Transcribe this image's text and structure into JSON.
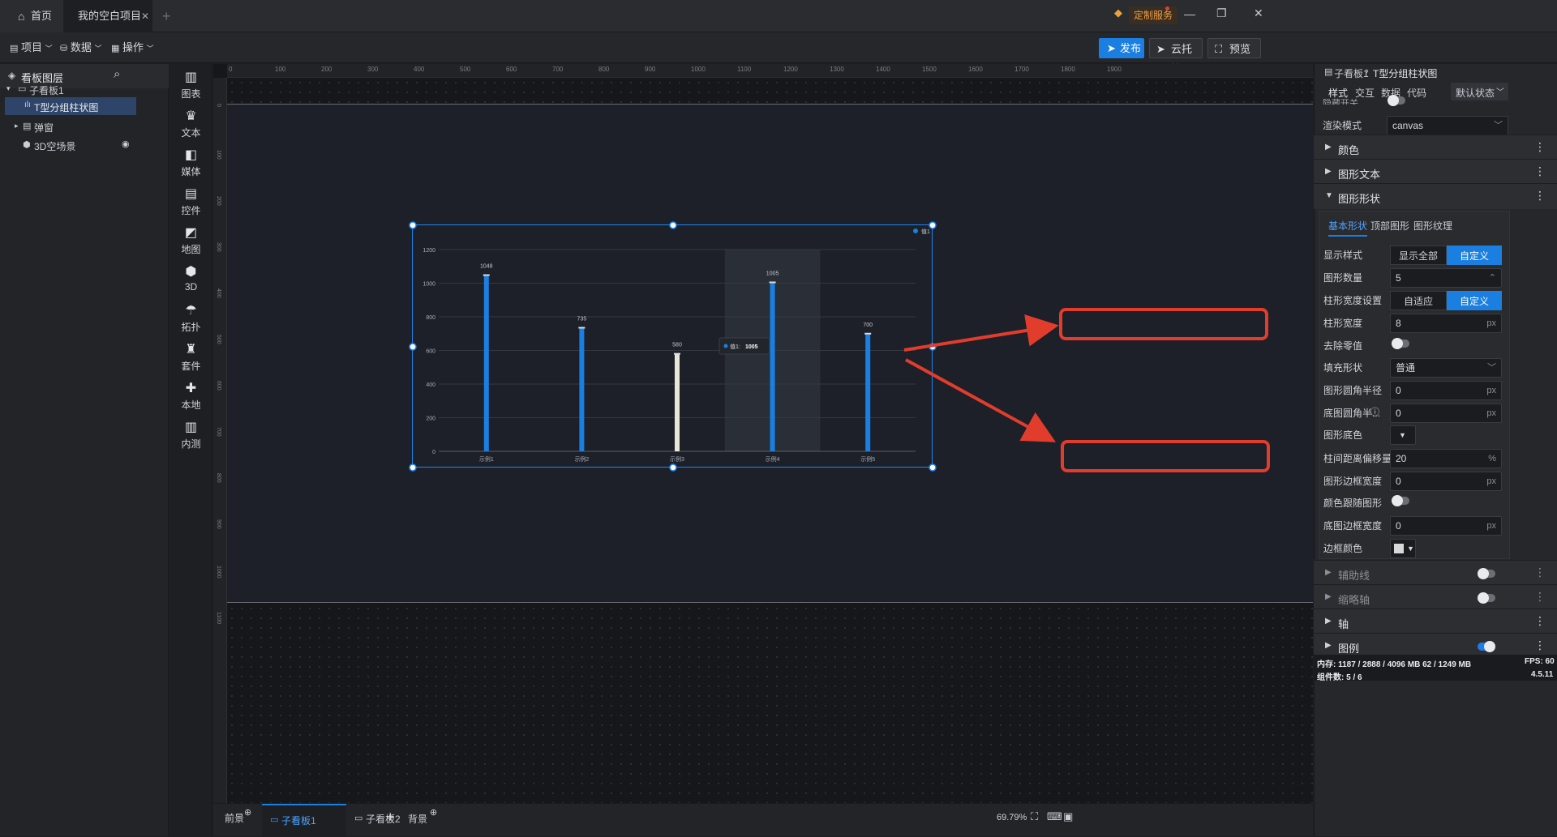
{
  "titlebar": {
    "home_tab": "首页",
    "project_tab": "我的空白项目",
    "custom_service": "定制服务"
  },
  "toolbar": {
    "menus": [
      "项目",
      "数据",
      "操作"
    ],
    "publish": "发布",
    "cloud_host": "云托管",
    "preview": "预览"
  },
  "layers": {
    "title": "看板图层",
    "items": [
      {
        "label": "子看板1"
      },
      {
        "label": "T型分组柱状图"
      },
      {
        "label": "弹窗"
      },
      {
        "label": "3D空场景"
      }
    ]
  },
  "components": [
    "图表",
    "文本",
    "媒体",
    "控件",
    "地图",
    "3D",
    "拓扑",
    "套件",
    "本地",
    "内测"
  ],
  "ruler": {
    "h_ticks": [
      "0",
      "100",
      "200",
      "300",
      "400",
      "500",
      "600",
      "700",
      "800",
      "900",
      "1000",
      "1100",
      "1200",
      "1300",
      "1400",
      "1500",
      "1600",
      "1700",
      "1800",
      "1900"
    ],
    "v_ticks": [
      "0",
      "100",
      "200",
      "300",
      "400",
      "500",
      "600",
      "700",
      "800",
      "900",
      "1000",
      "1100"
    ]
  },
  "chart_data": {
    "type": "bar",
    "categories": [
      "示例1",
      "示例2",
      "示例3",
      "示例4",
      "示例5"
    ],
    "series": [
      {
        "name": "值1",
        "values": [
          1048,
          735,
          580,
          1005,
          700
        ]
      }
    ],
    "ylim": [
      0,
      1200
    ],
    "yticks": [
      "0",
      "200",
      "400",
      "600",
      "800",
      "1000",
      "1200"
    ],
    "data_labels": [
      "1048",
      "735",
      "580",
      "1005",
      "700"
    ],
    "legend": "top-right",
    "tooltip": {
      "name": "值1",
      "value": "1005"
    },
    "grid": true,
    "bar_color": "#1a7fe0",
    "highlight_color": "#e8e6d6"
  },
  "bottom": {
    "foreground": "前景",
    "board1": "子看板1",
    "board2": "子看板2",
    "background": "背景",
    "zoom": "69.79%"
  },
  "panel": {
    "breadcrumb_root": "子看板1",
    "breadcrumb_item": "T型分组柱状图",
    "tabs": [
      "样式",
      "交互",
      "数据",
      "代码"
    ],
    "state": "默认状态",
    "cut_label": "隐藏开关",
    "render_mode_label": "渲染模式",
    "render_mode_value": "canvas",
    "sections": [
      "颜色",
      "图形文本",
      "图形形状"
    ],
    "subtabs": [
      "基本形状",
      "顶部图形",
      "图形纹理"
    ],
    "rows": {
      "display_style": "显示样式",
      "display_all": "显示全部",
      "custom": "自定义",
      "shape_count": "图形数量",
      "shape_count_value": "5",
      "bar_width_setting": "柱形宽度设置",
      "adaptive": "自适应",
      "custom2": "自定义",
      "bar_width": "柱形宽度",
      "bar_width_value": "8",
      "remove_zero": "去除零值",
      "fill_shape": "填充形状",
      "fill_shape_value": "普通",
      "corner_radius": "图形圆角半径",
      "corner_radius_value": "0",
      "base_radius": "底图圆角半...",
      "base_radius_value": "0",
      "base_color": "图形底色",
      "offset": "柱间距离偏移量",
      "offset_value": "20",
      "border_width": "图形边框宽度",
      "border_width_value": "0",
      "color_follow": "颜色跟随图形",
      "base_border": "底图边框宽度",
      "base_border_value": "0",
      "border_color": "边框颜色"
    },
    "units": {
      "px": "px",
      "percent": "%"
    },
    "sections2": [
      "辅助线",
      "缩略轴",
      "轴",
      "图例"
    ]
  },
  "status": {
    "memory": "内存: 1187 / 2888 / 4096 MB  62 / 1249 MB",
    "fps": "FPS: 60",
    "components": "组件数: 5 / 6",
    "version": "4.5.11"
  }
}
